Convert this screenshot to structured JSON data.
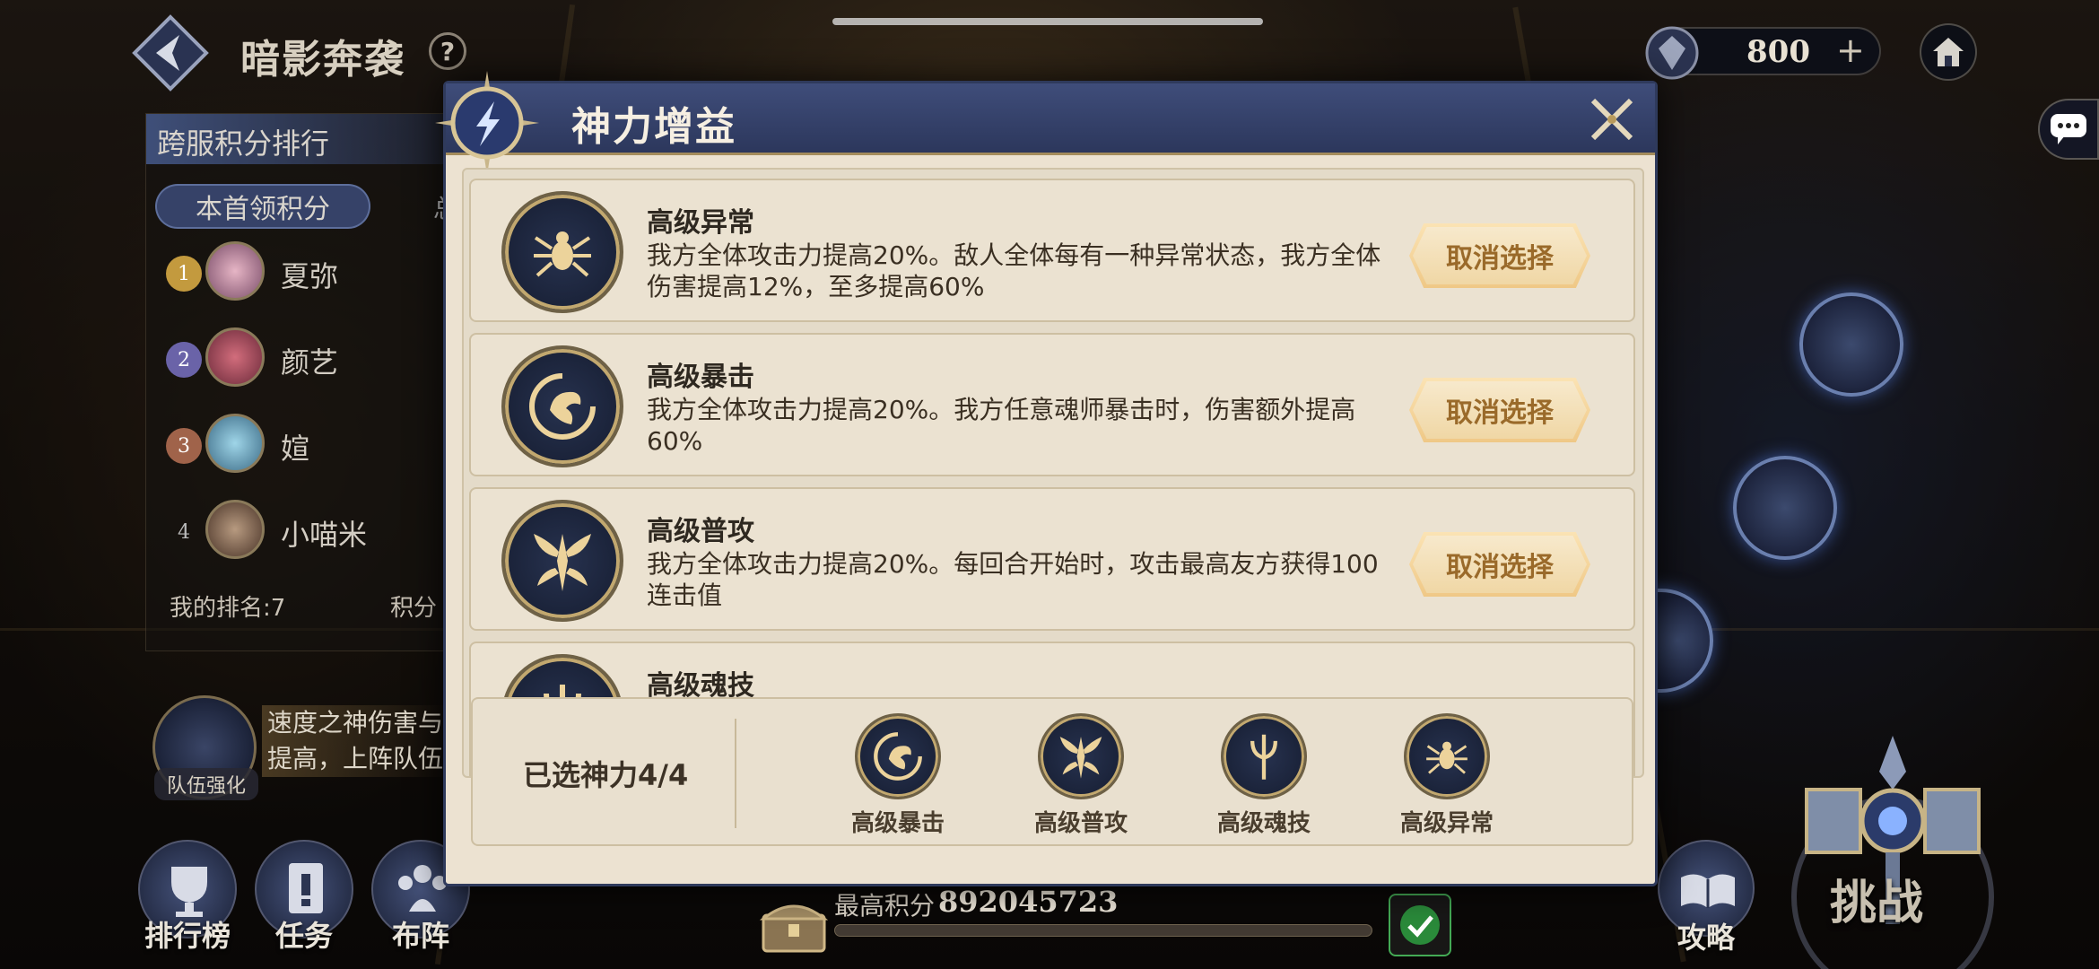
{
  "header": {
    "title": "暗影奔袭",
    "help_label": "?",
    "currency_value": "800",
    "currency_plus": "+"
  },
  "leaderboard": {
    "title": "跨服积分排行",
    "tab_active": "本首领积分",
    "tab_other": "总",
    "rows": [
      {
        "rank": "1",
        "name": "夏弥"
      },
      {
        "rank": "2",
        "name": "颜艺"
      },
      {
        "rank": "3",
        "name": "媗"
      },
      {
        "rank": "4",
        "name": "小喵米"
      }
    ],
    "my_rank": "我的排名:7",
    "score_label": "积分"
  },
  "team_buff": {
    "label": "队伍强化",
    "text": "速度之神伤害与提高，上阵队伍"
  },
  "bottom_left": {
    "leaderboard": "排行榜",
    "tasks": "任务",
    "formation": "布阵"
  },
  "bottom_center": {
    "max_score_label": "最高积分",
    "max_score_value": "892045723"
  },
  "bottom_right": {
    "strategy": "攻略",
    "challenge": "挑战"
  },
  "modal": {
    "title": "神力增益",
    "buffs": [
      {
        "icon": "spider-icon",
        "name": "高级异常",
        "desc": "我方全体攻击力提高20%。敌人全体每有一种异常状态，我方全体伤害提高12%，至多提高60%",
        "button": "取消选择"
      },
      {
        "icon": "dragon-icon",
        "name": "高级暴击",
        "desc": "我方全体攻击力提高20%。我方任意魂师暴击时，伤害额外提高60%",
        "button": "取消选择"
      },
      {
        "icon": "wings-icon",
        "name": "高级普攻",
        "desc": "我方全体攻击力提高20%。每回合开始时，攻击最高友方获得100连击值",
        "button": "取消选择"
      },
      {
        "icon": "trident-icon",
        "name": "高级魂技",
        "desc": "",
        "button": ""
      }
    ],
    "selected_label": "已选神力4/4",
    "selected": [
      {
        "icon": "dragon-icon",
        "label": "高级暴击"
      },
      {
        "icon": "wings-icon",
        "label": "高级普攻"
      },
      {
        "icon": "trident-icon",
        "label": "高级魂技"
      },
      {
        "icon": "spider-icon",
        "label": "高级异常"
      }
    ]
  },
  "colors": {
    "modal_header": "#2c375c",
    "modal_bg": "#ece2d1",
    "button_gold": "#efc886",
    "icon_gold": "#e8c98a"
  }
}
